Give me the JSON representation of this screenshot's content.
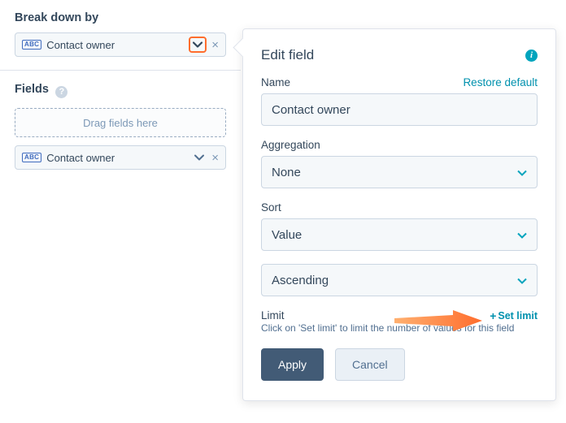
{
  "left": {
    "breakdown_label": "Break down by",
    "breakdown_pill": "Contact owner",
    "fields_label": "Fields",
    "dropzone_text": "Drag fields here",
    "field_pill": "Contact owner"
  },
  "popover": {
    "title": "Edit field",
    "name_label": "Name",
    "restore_link": "Restore default",
    "name_value": "Contact owner",
    "aggregation_label": "Aggregation",
    "aggregation_value": "None",
    "sort_label": "Sort",
    "sort_value": "Value",
    "sort_order": "Ascending",
    "limit_label": "Limit",
    "set_limit_link": "Set limit",
    "limit_hint": "Click on 'Set limit' to limit the number of values for this field",
    "apply_btn": "Apply",
    "cancel_btn": "Cancel"
  },
  "icons": {
    "abc": "ABC"
  }
}
